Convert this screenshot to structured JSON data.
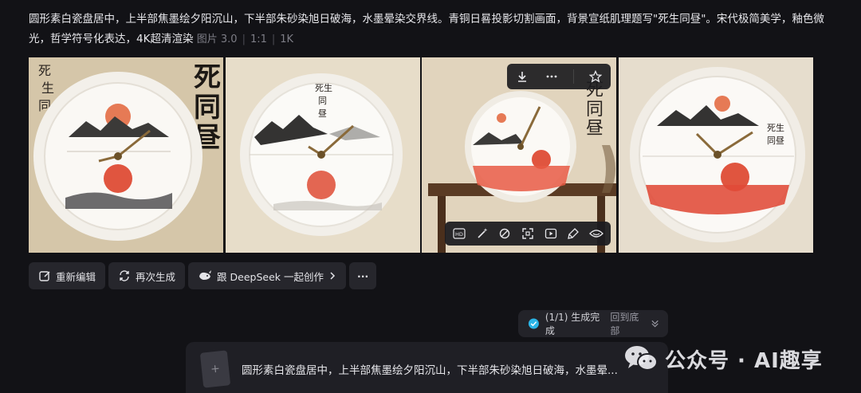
{
  "prompt": {
    "text": "圆形素白瓷盘居中，上半部焦墨绘夕阳沉山，下半部朱砂染旭日破海，水墨晕染交界线。青铜日晷投影切割画面，背景宣纸肌理题写\"死生同昼\"。宋代极简美学，釉色微光，哲学符号化表达，4K超清渲染",
    "model": "图片 3.0",
    "ratio": "1:1",
    "resolution": "1K"
  },
  "images": {
    "tile1_calligraphy_left": "死\n生\n同\n昼",
    "tile1_calligraphy_right": "死同昼",
    "tile2_calligraphy": "死生同昼",
    "tile3_calligraphy": "死同昼",
    "tile4_calligraphy": "死生同昼"
  },
  "image_toolbar": {
    "icons": [
      "download-icon",
      "more-icon",
      "star-icon"
    ]
  },
  "edit_toolbar": {
    "hd_label": "HD",
    "icons": [
      "hd-icon",
      "magic-wand-icon",
      "eraser-icon",
      "expand-icon",
      "video-icon",
      "brush-icon",
      "eye-icon"
    ]
  },
  "actions": {
    "reedit": "重新编辑",
    "regenerate": "再次生成",
    "deepseek": "跟 DeepSeek 一起创作",
    "more": "···"
  },
  "status": {
    "text": "(1/1) 生成完成",
    "link": "回到底部"
  },
  "composer": {
    "text": "圆形素白瓷盘居中，上半部焦墨绘夕阳沉山，下半部朱砂染旭日破海，水墨晕..."
  },
  "watermark": {
    "text": "公众号 · AI趣享"
  },
  "colors": {
    "background": "#121216",
    "button": "#26262c",
    "accent_check": "#2bb4e6",
    "sun_red": "#e0553f"
  }
}
